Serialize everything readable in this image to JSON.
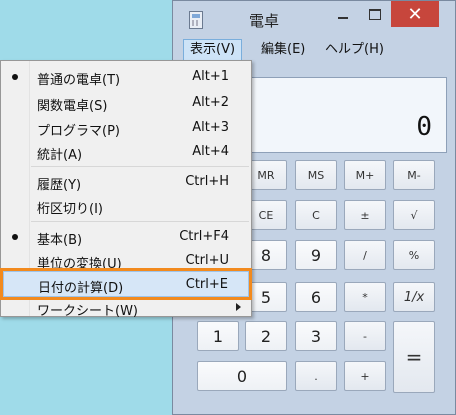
{
  "window": {
    "title": "電卓",
    "close_glyph": "✕"
  },
  "menubar": {
    "view": "表示(V)",
    "edit": "編集(E)",
    "help": "ヘルプ(H)"
  },
  "display": {
    "value": "0"
  },
  "keys": {
    "mr": "MR",
    "ms": "MS",
    "mplus": "M+",
    "mminus": "M-",
    "ce": "CE",
    "c": "C",
    "pm": "±",
    "sqrt": "√",
    "n8": "8",
    "n9": "9",
    "div": "/",
    "pct": "%",
    "n5": "5",
    "n6": "6",
    "mul": "*",
    "recip": "1/x",
    "n1": "1",
    "n2": "2",
    "n3": "3",
    "minus": "-",
    "n0": "0",
    "dot": ".",
    "plus": "+",
    "eq": "="
  },
  "menu": {
    "items": [
      {
        "label": "普通の電卓(T)",
        "shortcut": "Alt+1",
        "checked": true
      },
      {
        "label": "関数電卓(S)",
        "shortcut": "Alt+2"
      },
      {
        "label": "プログラマ(P)",
        "shortcut": "Alt+3"
      },
      {
        "label": "統計(A)",
        "shortcut": "Alt+4"
      },
      {
        "label": "履歴(Y)",
        "shortcut": "Ctrl+H"
      },
      {
        "label": "桁区切り(I)",
        "shortcut": ""
      },
      {
        "label": "基本(B)",
        "shortcut": "Ctrl+F4",
        "checked": true
      },
      {
        "label": "単位の変換(U)",
        "shortcut": "Ctrl+U"
      },
      {
        "label": "日付の計算(D)",
        "shortcut": "Ctrl+E",
        "highlighted": true
      },
      {
        "label": "ワークシート(W)",
        "shortcut": "",
        "submenu": true
      }
    ]
  },
  "colors": {
    "highlight_outline": "#f28a1e",
    "close_button": "#c7463c"
  }
}
